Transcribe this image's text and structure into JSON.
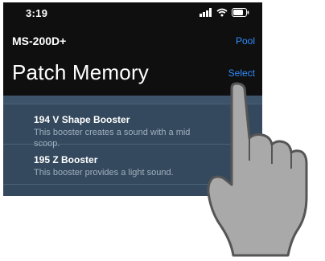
{
  "status_bar": {
    "time": "3:19",
    "signal_icon": "signal-bars-icon",
    "wifi_icon": "wifi-icon",
    "battery_icon": "battery-icon"
  },
  "nav": {
    "device_name": "MS-200D+",
    "pool_label": "Pool",
    "title": "Patch Memory",
    "select_label": "Select"
  },
  "patches": [
    {
      "title": "194 V Shape Booster",
      "description": "This booster creates a sound with a mid scoop."
    },
    {
      "title": "195 Z Booster",
      "description": "This booster provides a light sound."
    }
  ],
  "overlay": {
    "icon": "pointing-hand-icon",
    "colors": {
      "hand_fill": "#a9a9a9",
      "hand_stroke": "#555555"
    }
  },
  "colors": {
    "accent": "#2f8cff",
    "background": "#0f0f0f",
    "list_background": "#34495d"
  }
}
